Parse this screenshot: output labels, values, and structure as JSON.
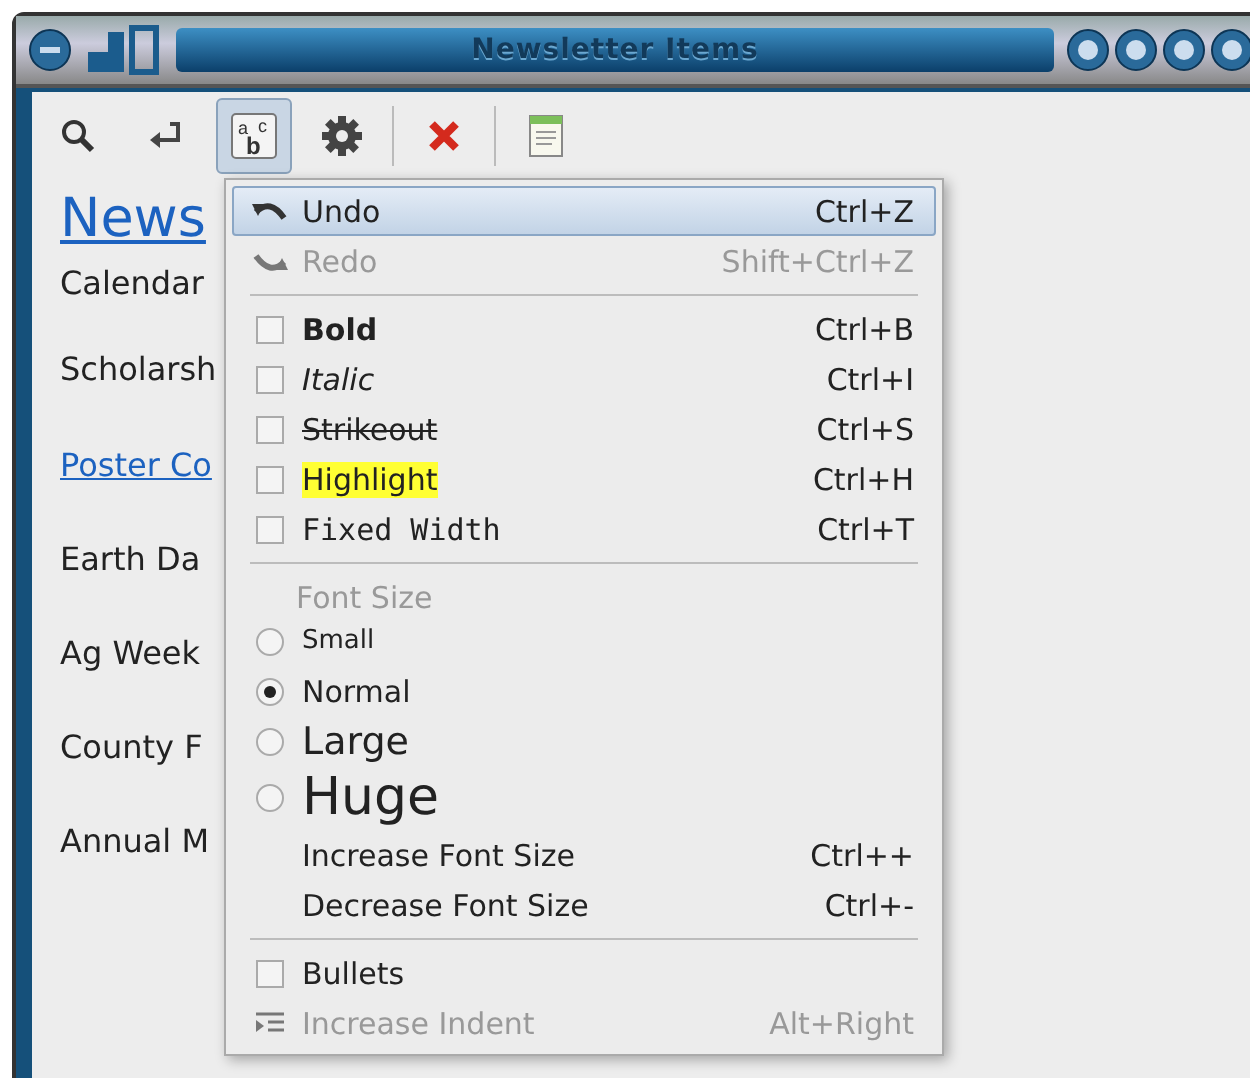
{
  "window": {
    "title": "Newsletter Items"
  },
  "toolbar": [
    {
      "kind": "button",
      "pressed": false
    },
    {
      "kind": "button",
      "pressed": false
    },
    {
      "kind": "button",
      "pressed": true,
      "glyphs": [
        "a",
        "c",
        "b"
      ]
    },
    {
      "kind": "button",
      "pressed": false
    },
    {
      "kind": "separator"
    },
    {
      "kind": "button",
      "pressed": false
    },
    {
      "kind": "separator"
    },
    {
      "kind": "button",
      "pressed": false
    }
  ],
  "content": [
    {
      "kind": "heading",
      "text": "News"
    },
    {
      "kind": "text",
      "text": "Calendar"
    },
    {
      "kind": "text",
      "text": "Scholarsh"
    },
    {
      "kind": "link",
      "text": "Poster Co"
    },
    {
      "kind": "text",
      "text": "Earth Da"
    },
    {
      "kind": "text",
      "text": "Ag Week"
    },
    {
      "kind": "text",
      "text": "County F"
    },
    {
      "kind": "text",
      "text": "Annual M"
    }
  ],
  "menu": [
    {
      "kind": "action",
      "label": "Undo",
      "shortcut": "Ctrl+Z",
      "disabled": false,
      "selected": true
    },
    {
      "kind": "action",
      "label": "Redo",
      "shortcut": "Shift+Ctrl+Z",
      "disabled": true,
      "selected": false
    },
    {
      "kind": "separator"
    },
    {
      "kind": "check",
      "label": "Bold",
      "shortcut": "Ctrl+B",
      "checked": false
    },
    {
      "kind": "check",
      "label": "Italic",
      "shortcut": "Ctrl+I",
      "checked": false
    },
    {
      "kind": "check",
      "label": "Strikeout",
      "shortcut": "Ctrl+S",
      "checked": false
    },
    {
      "kind": "check",
      "label": "Highlight",
      "shortcut": "Ctrl+H",
      "checked": false
    },
    {
      "kind": "check",
      "label": "Fixed Width",
      "shortcut": "Ctrl+T",
      "checked": false
    },
    {
      "kind": "separator"
    },
    {
      "kind": "header",
      "label": "Font Size"
    },
    {
      "kind": "radio",
      "label": "Small",
      "selected": false
    },
    {
      "kind": "radio",
      "label": "Normal",
      "selected": true
    },
    {
      "kind": "radio",
      "label": "Large",
      "selected": false
    },
    {
      "kind": "radio",
      "label": "Huge",
      "selected": false
    },
    {
      "kind": "plain",
      "label": "Increase Font Size",
      "shortcut": "Ctrl++"
    },
    {
      "kind": "plain",
      "label": "Decrease Font Size",
      "shortcut": "Ctrl+-"
    },
    {
      "kind": "separator"
    },
    {
      "kind": "check",
      "label": "Bullets",
      "checked": false
    },
    {
      "kind": "action",
      "label": "Increase Indent",
      "shortcut": "Alt+Right",
      "disabled": true,
      "selected": false
    }
  ]
}
